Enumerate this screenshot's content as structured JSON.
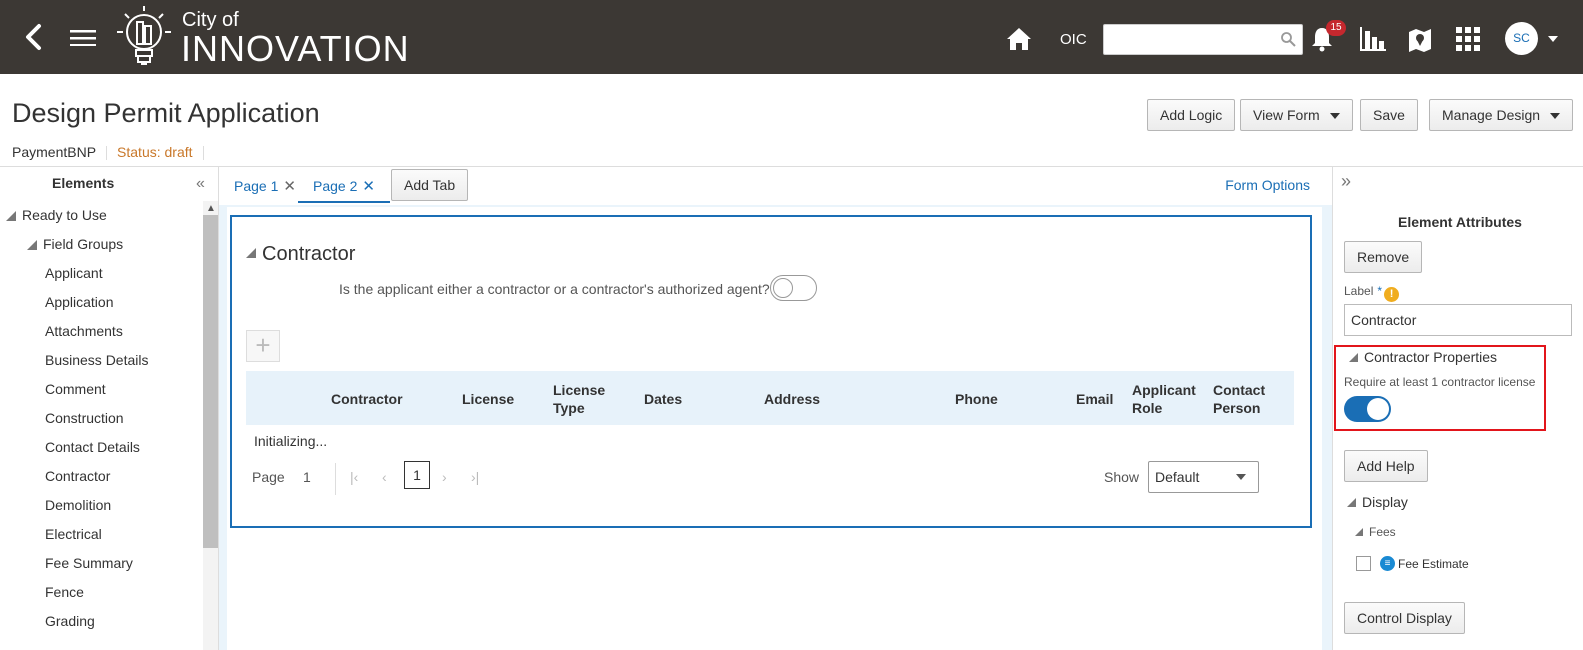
{
  "header": {
    "brand_small": "City of",
    "brand_large": "INNOVATION",
    "oic_label": "OIC",
    "search_placeholder": "",
    "notification_count": "15",
    "avatar_initials": "SC"
  },
  "page": {
    "title": "Design Permit Application",
    "subtitle_name": "PaymentBNP",
    "status": "Status: draft"
  },
  "toolbar": {
    "add_logic": "Add Logic",
    "view_form": "View Form",
    "save": "Save",
    "manage_design": "Manage Design"
  },
  "elements_panel": {
    "title": "Elements",
    "root": "Ready to Use",
    "group": "Field Groups",
    "items": [
      "Applicant",
      "Application",
      "Attachments",
      "Business Details",
      "Comment",
      "Construction",
      "Contact Details",
      "Contractor",
      "Demolition",
      "Electrical",
      "Fee Summary",
      "Fence",
      "Grading"
    ]
  },
  "tabs": {
    "items": [
      {
        "label": "Page 1",
        "active": false
      },
      {
        "label": "Page 2",
        "active": true
      }
    ],
    "add_tab": "Add Tab",
    "form_options": "Form Options"
  },
  "section": {
    "title": "Contractor",
    "question": "Is the applicant either a contractor or a contractor's authorized agent?",
    "question_toggle_on": false,
    "columns": [
      "Contractor",
      "License",
      "License Type",
      "Dates",
      "Address",
      "Phone",
      "Email",
      "Applicant Role",
      "Contact Person"
    ],
    "loading_text": "Initializing...",
    "pager": {
      "page_label": "Page",
      "page_number": "1",
      "current": "1",
      "show_label": "Show",
      "show_value": "Default"
    }
  },
  "attributes_panel": {
    "title": "Element Attributes",
    "remove": "Remove",
    "label_caption": "Label",
    "required_mark": "*",
    "label_value": "Contractor",
    "properties_title": "Contractor Properties",
    "require_license_text": "Require at least 1 contractor license",
    "require_license_on": true,
    "add_help": "Add Help",
    "display_title": "Display",
    "fees_title": "Fees",
    "fee_estimate": "Fee Estimate",
    "control_display": "Control Display"
  },
  "colors": {
    "topbar": "#3c3834",
    "accent": "#1a6eb5",
    "status": "#c9782a",
    "badge": "#c5282e",
    "highlight_box": "#e2151b"
  }
}
